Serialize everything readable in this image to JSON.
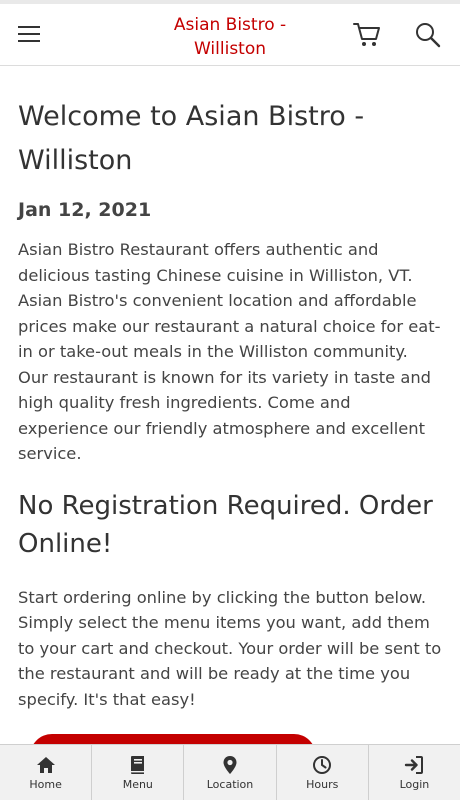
{
  "header": {
    "brand_line1": "Asian Bistro -",
    "brand_line2": "Williston",
    "brand_color": "#c40000",
    "icons": [
      "hamburger-menu-icon",
      "cart-icon",
      "search-icon"
    ]
  },
  "main": {
    "title": "Welcome to Asian Bistro - Williston",
    "date": "Jan 12, 2021",
    "intro": "Asian Bistro Restaurant offers authentic and delicious tasting Chinese cuisine in Williston, VT. Asian Bistro's convenient location and affordable prices make our restaurant a natural choice for eat-in or take-out meals in the Williston community. Our restaurant is known for its variety in taste and high quality fresh ingredients. Come and experience our friendly atmosphere and excellent service.",
    "section_title": "No Registration Required. Order Online!",
    "instructions": "Start ordering online by clicking the button below. Simply select the menu items you want, add them to your cart and checkout. Your order will be sent to the restaurant and will be ready at the time you specify. It's that easy!"
  },
  "bottom_nav": {
    "items": [
      {
        "label": "Home",
        "icon": "home-icon"
      },
      {
        "label": "Menu",
        "icon": "book-icon"
      },
      {
        "label": "Location",
        "icon": "map-pin-icon"
      },
      {
        "label": "Hours",
        "icon": "clock-icon"
      },
      {
        "label": "Login",
        "icon": "sign-in-icon"
      }
    ]
  }
}
